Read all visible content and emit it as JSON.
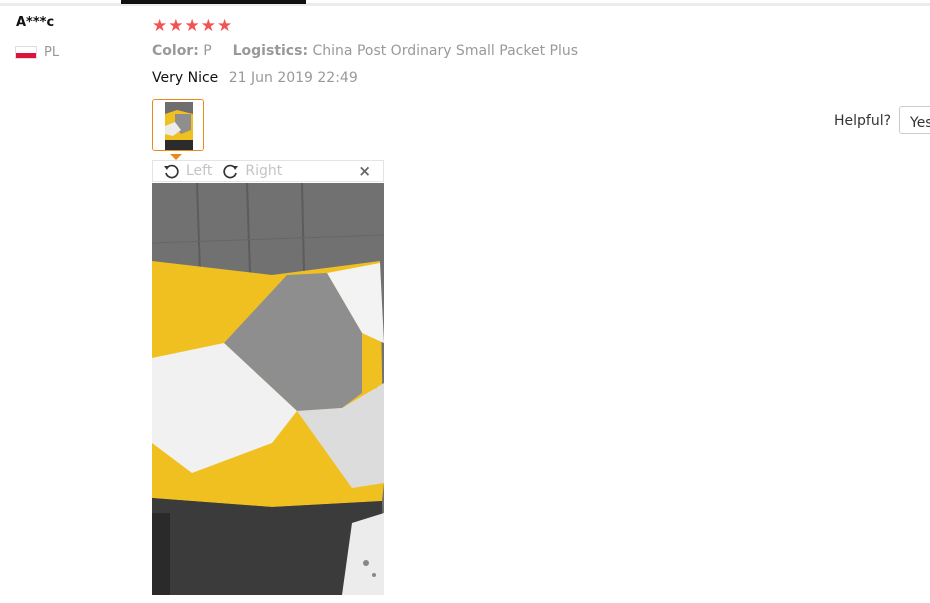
{
  "reviewer": {
    "name": "A***c",
    "country": "PL"
  },
  "rating": {
    "stars": 5,
    "max": 5,
    "star_color": "#f25353"
  },
  "order_info": {
    "color_label": "Color:",
    "color_value": "P",
    "logistics_label": "Logistics:",
    "logistics_value": "China Post Ordinary Small Packet Plus"
  },
  "review": {
    "text": "Very Nice",
    "date": "21 Jun 2019 22:49"
  },
  "image_viewer": {
    "rotate_left_label": "Left",
    "rotate_right_label": "Right",
    "close_label": "×"
  },
  "helpful": {
    "label": "Helpful?",
    "yes_label": "Yes"
  },
  "colors": {
    "accent_orange": "#e8891c",
    "muted_text": "#999999",
    "pillow_yellow": "#f0c020",
    "pillow_gray": "#8e8e8e"
  }
}
